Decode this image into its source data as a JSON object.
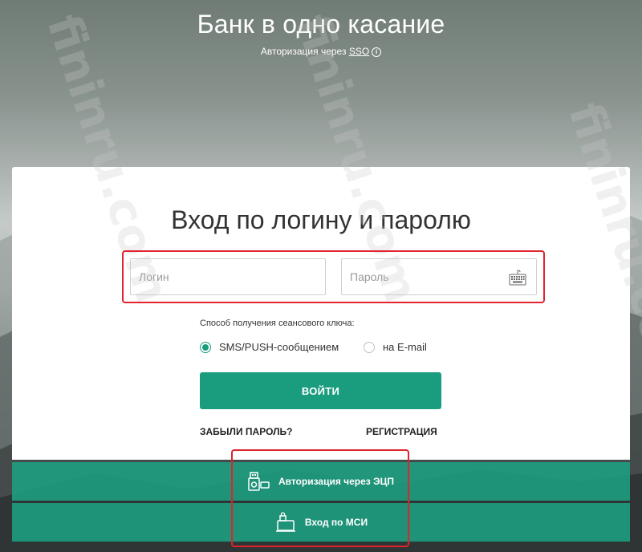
{
  "header": {
    "title": "Банк в одно касание",
    "subtitle_prefix": "Авторизация через ",
    "sso_link": "SSO",
    "info_icon": "i"
  },
  "login_card": {
    "title": "Вход по логину и паролю",
    "login_placeholder": "Логин",
    "password_placeholder": "Пароль",
    "session_key_label": "Способ получения сеансового ключа:",
    "options": [
      {
        "label": "SMS/PUSH-сообщением",
        "checked": true
      },
      {
        "label": "на E-mail",
        "checked": false
      }
    ],
    "submit_label": "ВОЙТИ",
    "forgot_label": "ЗАБЫЛИ ПАРОЛЬ?",
    "register_label": "РЕГИСТРАЦИЯ"
  },
  "alt_auth": {
    "eds_label": "Авторизация через ЭЦП",
    "msi_label": "Вход по МСИ"
  },
  "watermark": "fininru.com",
  "colors": {
    "accent": "#1a9d7e",
    "highlight": "#e0232e"
  }
}
